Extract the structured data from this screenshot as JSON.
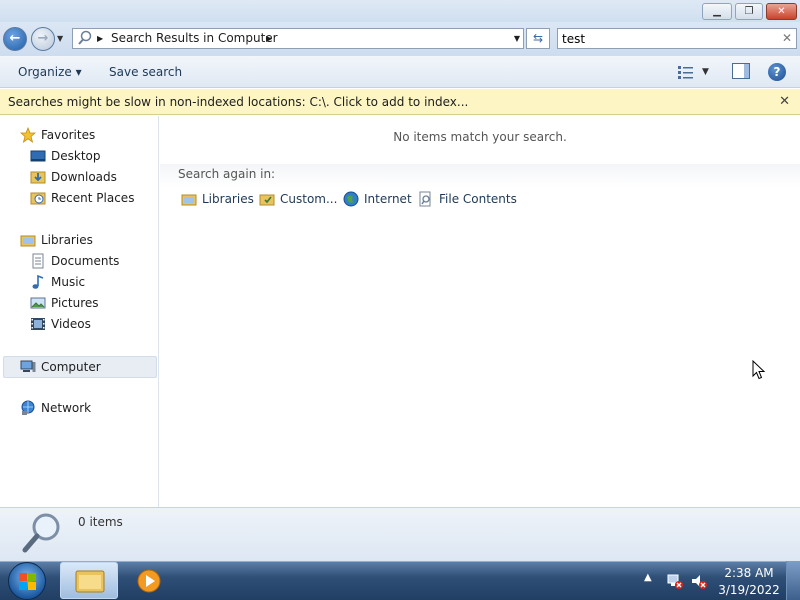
{
  "window": {
    "minimize_glyph": "▁",
    "maximize_glyph": "❐",
    "close_glyph": "✕"
  },
  "address": {
    "path": "Search Results in Computer",
    "back_glyph": "←",
    "forward_glyph": "→",
    "recent_glyph": "▼",
    "sep_glyph": "▶",
    "dropdown_glyph": "▼",
    "refresh_glyph": "⇆"
  },
  "search": {
    "value": "test",
    "clear_glyph": "✕"
  },
  "toolbar": {
    "organize_label": "Organize ▾",
    "save_search_label": "Save search",
    "views_dropdown_glyph": "▼",
    "help_glyph": "?"
  },
  "infobar": {
    "message": "Searches might be slow in non-indexed locations: C:\\. Click to add to index...",
    "close_glyph": "✕"
  },
  "navpane": {
    "favorites": "Favorites",
    "desktop": "Desktop",
    "downloads": "Downloads",
    "recent_places": "Recent Places",
    "libraries": "Libraries",
    "documents": "Documents",
    "music": "Music",
    "pictures": "Pictures",
    "videos": "Videos",
    "computer": "Computer",
    "network": "Network"
  },
  "content": {
    "empty_message": "No items match your search.",
    "search_again_label": "Search again in:",
    "search_again_options": [
      "Libraries",
      "Custom...",
      "Internet",
      "File Contents"
    ]
  },
  "details": {
    "count": "0 items"
  },
  "taskbar": {
    "tray_up_glyph": "▲",
    "time": "2:38 AM",
    "date": "3/19/2022"
  },
  "colors": {
    "infobar_bg": "#fdf6c4",
    "selected_nav_bg": "#e8edf4",
    "taskbar": "#213e63"
  }
}
